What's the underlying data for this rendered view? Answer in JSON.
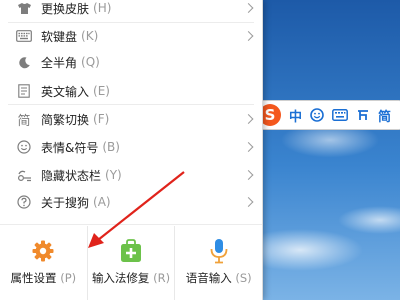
{
  "menu": {
    "items": [
      {
        "label": "更换皮肤",
        "key": "(H)",
        "icon": "shirt-icon",
        "submenu": true
      },
      {
        "label": "软键盘",
        "key": "(K)",
        "icon": "keyboard-icon",
        "submenu": true
      },
      {
        "label": "全半角",
        "key": "(Q)",
        "icon": "moon-icon",
        "submenu": false
      },
      {
        "label": "英文输入",
        "key": "(E)",
        "icon": "document-icon",
        "submenu": false
      },
      {
        "label": "简繁切换",
        "key": "(F)",
        "icon": "simplified-char-icon",
        "submenu": true
      },
      {
        "label": "表情&符号",
        "key": "(B)",
        "icon": "smiley-icon",
        "submenu": true
      },
      {
        "label": "隐藏状态栏",
        "key": "(Y)",
        "icon": "hide-bar-icon",
        "submenu": true
      },
      {
        "label": "关于搜狗",
        "key": "(A)",
        "icon": "help-icon",
        "submenu": true
      }
    ],
    "bottom": [
      {
        "label": "属性设置",
        "key": "(P)",
        "icon": "gear-icon",
        "color": "#f08a2c"
      },
      {
        "label": "输入法修复",
        "key": "(R)",
        "icon": "repair-bag-icon",
        "color": "#6cc24a"
      },
      {
        "label": "语音输入",
        "key": "(S)",
        "icon": "microphone-icon",
        "color": "#2f8de4"
      }
    ],
    "simplified_glyph": "简"
  },
  "toolbar": {
    "logo": "S",
    "lang": "中",
    "simplified": "简",
    "accent": "#1b6fd4",
    "logo_color": "#f4581e"
  },
  "annotation": {
    "color": "#e0231b"
  }
}
